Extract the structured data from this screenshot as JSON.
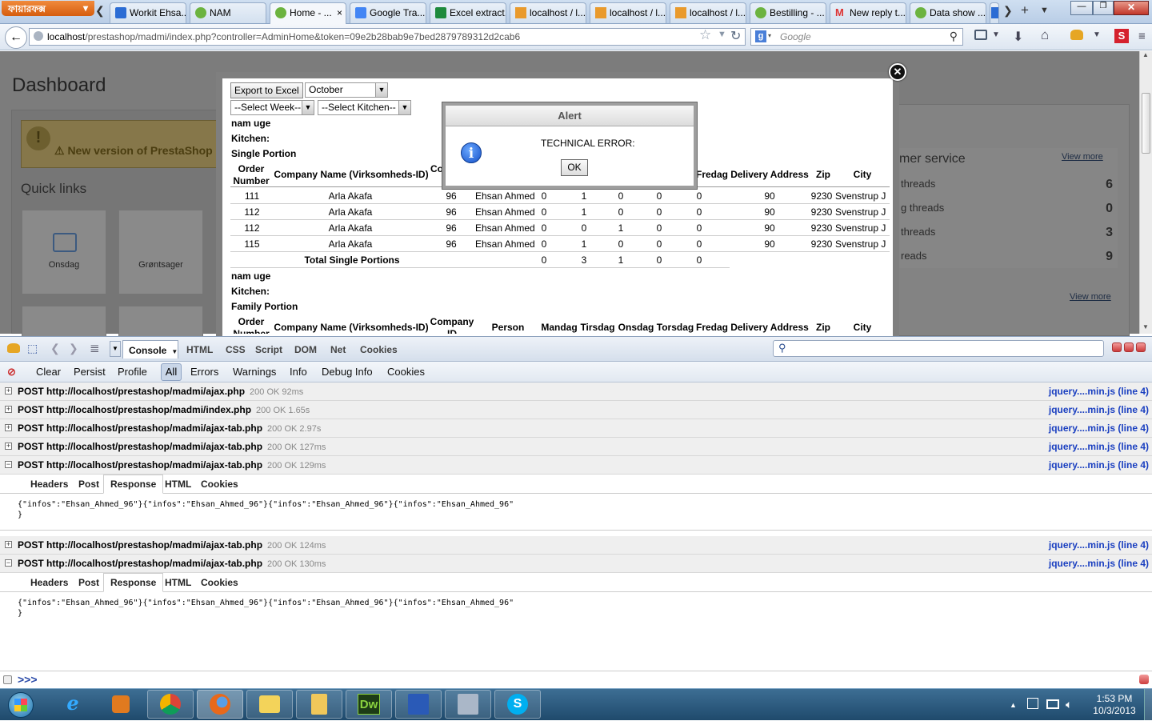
{
  "browser": {
    "menu_label": "ফায়ারফক্স",
    "tabs": [
      {
        "label": "Workit Ehsa..."
      },
      {
        "label": "NAM"
      },
      {
        "label": "Home - ..."
      },
      {
        "label": "Google Tra..."
      },
      {
        "label": "Excel extract..."
      },
      {
        "label": "localhost / l..."
      },
      {
        "label": "localhost / l..."
      },
      {
        "label": "localhost / l..."
      },
      {
        "label": "Bestilling - ..."
      },
      {
        "label": "New reply t..."
      },
      {
        "label": "Data show ..."
      }
    ],
    "url_host": "localhost",
    "url_path": "/prestashop/madmi/index.php?controller=AdminHome&token=09e2b28bab9e7bed2879789312d2cab6",
    "search_placeholder": "Google",
    "search_engine_letter": "g"
  },
  "page": {
    "title": "Dashboard",
    "warning": "⚠ New version of PrestaShop",
    "quick_links_title": "Quick links",
    "quick_links": [
      {
        "label": "Onsdag"
      },
      {
        "label": "Grøntsager"
      }
    ],
    "customer_service": {
      "title": "mer service",
      "view_more": "View more",
      "rows": [
        {
          "label": "threads",
          "value": "6"
        },
        {
          "label": "g threads",
          "value": "0"
        },
        {
          "label": "threads",
          "value": "3"
        },
        {
          "label": "reads",
          "value": "9"
        }
      ],
      "view_more_2": "View more"
    }
  },
  "modal": {
    "close": "×",
    "export_btn": "Export to Excel",
    "month_select": "October",
    "week_select": "--Select Week--",
    "kitchen_select": "--Select Kitchen--",
    "section1": {
      "nam": "nam uge",
      "kitchen": "Kitchen:",
      "portion": "Single Portion"
    },
    "headers": {
      "order": "Order Number",
      "company": "Company Name (Virksomheds-ID)",
      "company_id_cut": "Co",
      "company_id": "Company ID",
      "person": "Person",
      "mandag": "Mandag",
      "tirsdag": "Tirsdag",
      "onsdag": "Onsdag",
      "torsdag": "Torsdag",
      "fredag": "Fredag",
      "delivery": "Delivery Address",
      "zip": "Zip",
      "city": "City"
    },
    "rows": [
      {
        "order": "111",
        "company": "Arla Akafa",
        "cid": "96",
        "person": "Ehsan Ahmed",
        "man": "0",
        "tir": "1",
        "ons": "0",
        "tor": "0",
        "fre": "0",
        "addr": "90",
        "zip": "9230",
        "city": "Svenstrup J"
      },
      {
        "order": "112",
        "company": "Arla Akafa",
        "cid": "96",
        "person": "Ehsan Ahmed",
        "man": "0",
        "tir": "1",
        "ons": "0",
        "tor": "0",
        "fre": "0",
        "addr": "90",
        "zip": "9230",
        "city": "Svenstrup J"
      },
      {
        "order": "112",
        "company": "Arla Akafa",
        "cid": "96",
        "person": "Ehsan Ahmed",
        "man": "0",
        "tir": "0",
        "ons": "1",
        "tor": "0",
        "fre": "0",
        "addr": "90",
        "zip": "9230",
        "city": "Svenstrup J"
      },
      {
        "order": "115",
        "company": "Arla Akafa",
        "cid": "96",
        "person": "Ehsan Ahmed",
        "man": "0",
        "tir": "1",
        "ons": "0",
        "tor": "0",
        "fre": "0",
        "addr": "90",
        "zip": "9230",
        "city": "Svenstrup J"
      }
    ],
    "total": {
      "label": "Total Single Portions",
      "man": "0",
      "tir": "3",
      "ons": "1",
      "tor": "0",
      "fre": "0"
    },
    "section2": {
      "nam": "nam uge",
      "kitchen": "Kitchen:",
      "portion": "Family Portion"
    }
  },
  "alert": {
    "title": "Alert",
    "message": "TECHNICAL ERROR:",
    "ok": "OK"
  },
  "firebug": {
    "tabs": {
      "console": "Console",
      "html": "HTML",
      "css": "CSS",
      "script": "Script",
      "dom": "DOM",
      "net": "Net",
      "cookies": "Cookies"
    },
    "filters": {
      "clear": "Clear",
      "persist": "Persist",
      "profile": "Profile",
      "all": "All",
      "errors": "Errors",
      "warnings": "Warnings",
      "info": "Info",
      "debug": "Debug Info",
      "cookies": "Cookies"
    },
    "log": [
      {
        "toggle": "+",
        "url": "POST http://localhost/prestashop/madmi/ajax.php",
        "status": "200 OK 92ms",
        "source": "jquery....min.js (line 4)"
      },
      {
        "toggle": "+",
        "url": "POST http://localhost/prestashop/madmi/index.php",
        "status": "200 OK 1.65s",
        "source": "jquery....min.js (line 4)"
      },
      {
        "toggle": "+",
        "url": "POST http://localhost/prestashop/madmi/ajax-tab.php",
        "status": "200 OK 2.97s",
        "source": "jquery....min.js (line 4)"
      },
      {
        "toggle": "+",
        "url": "POST http://localhost/prestashop/madmi/ajax-tab.php",
        "status": "200 OK 127ms",
        "source": "jquery....min.js (line 4)"
      },
      {
        "toggle": "−",
        "url": "POST http://localhost/prestashop/madmi/ajax-tab.php",
        "status": "200 OK 129ms",
        "source": "jquery....min.js (line 4)"
      },
      {
        "toggle": "+",
        "url": "POST http://localhost/prestashop/madmi/ajax-tab.php",
        "status": "200 OK 124ms",
        "source": "jquery....min.js (line 4)"
      },
      {
        "toggle": "−",
        "url": "POST http://localhost/prestashop/madmi/ajax-tab.php",
        "status": "200 OK 130ms",
        "source": "jquery....min.js (line 4)"
      }
    ],
    "subtabs": {
      "headers": "Headers",
      "post": "Post",
      "response": "Response",
      "html": "HTML",
      "cookies": "Cookies"
    },
    "response_line": "{\"infos\":\"Ehsan_Ahmed_96\"}{\"infos\":\"Ehsan_Ahmed_96\"}{\"infos\":\"Ehsan_Ahmed_96\"}{\"infos\":\"Ehsan_Ahmed_96\"",
    "response_end": "}",
    "prompt": ">>>"
  },
  "taskbar": {
    "time": "1:53 PM",
    "date": "10/3/2013",
    "dw_label": "Dw",
    "skype_label": "S"
  }
}
